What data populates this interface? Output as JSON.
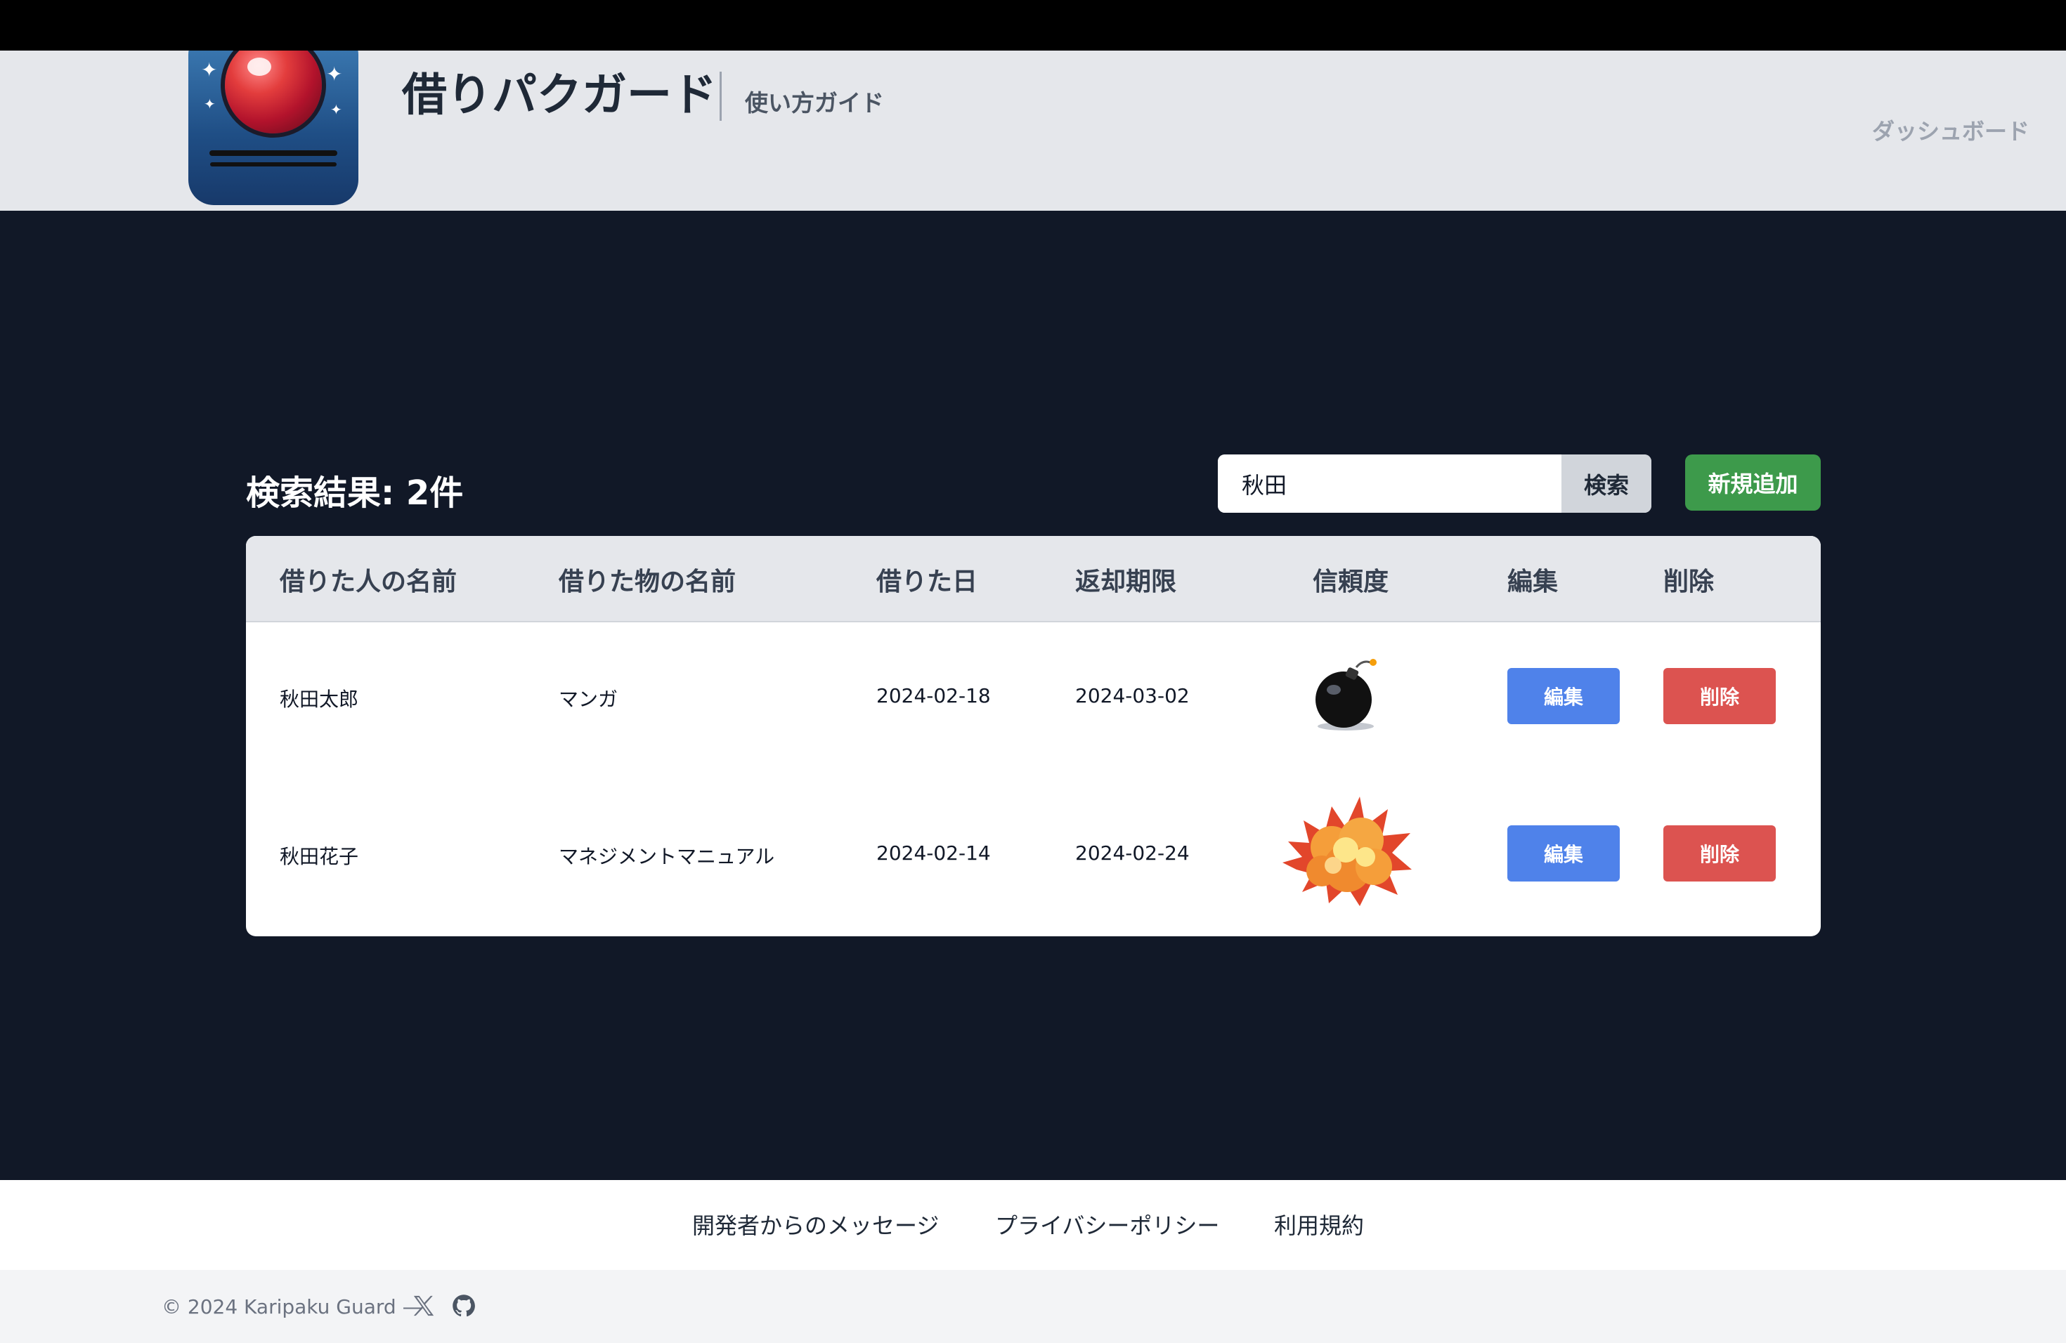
{
  "header": {
    "app_title": "借りパクガード",
    "guide_link": "使い方ガイド",
    "dashboard_link": "ダッシュボード"
  },
  "results": {
    "title": "検索結果: 2件",
    "search_value": "秋田",
    "search_button": "検索",
    "add_button": "新規追加"
  },
  "table": {
    "headers": [
      "借りた人の名前",
      "借りた物の名前",
      "借りた日",
      "返却期限",
      "信頼度",
      "編集",
      "削除"
    ],
    "rows": [
      {
        "borrower": "秋田太郎",
        "item": "マンガ",
        "borrowed": "2024-02-18",
        "due": "2024-03-02",
        "trust_icon": "bomb-icon",
        "edit": "編集",
        "delete": "削除"
      },
      {
        "borrower": "秋田花子",
        "item": "マネジメントマニュアル",
        "borrowed": "2024-02-14",
        "due": "2024-02-24",
        "trust_icon": "explosion-icon",
        "edit": "編集",
        "delete": "削除"
      }
    ]
  },
  "footer": {
    "links": [
      "開発者からのメッセージ",
      "プライバシーポリシー",
      "利用規約"
    ],
    "copyright": "© 2024 Karipaku Guard —",
    "social_icons": [
      "x-icon",
      "github-icon"
    ]
  },
  "colors": {
    "accent_green": "#3d9a4b",
    "edit_blue": "#4f82ea",
    "delete_red": "#dc5350",
    "background_dark": "#111827"
  }
}
